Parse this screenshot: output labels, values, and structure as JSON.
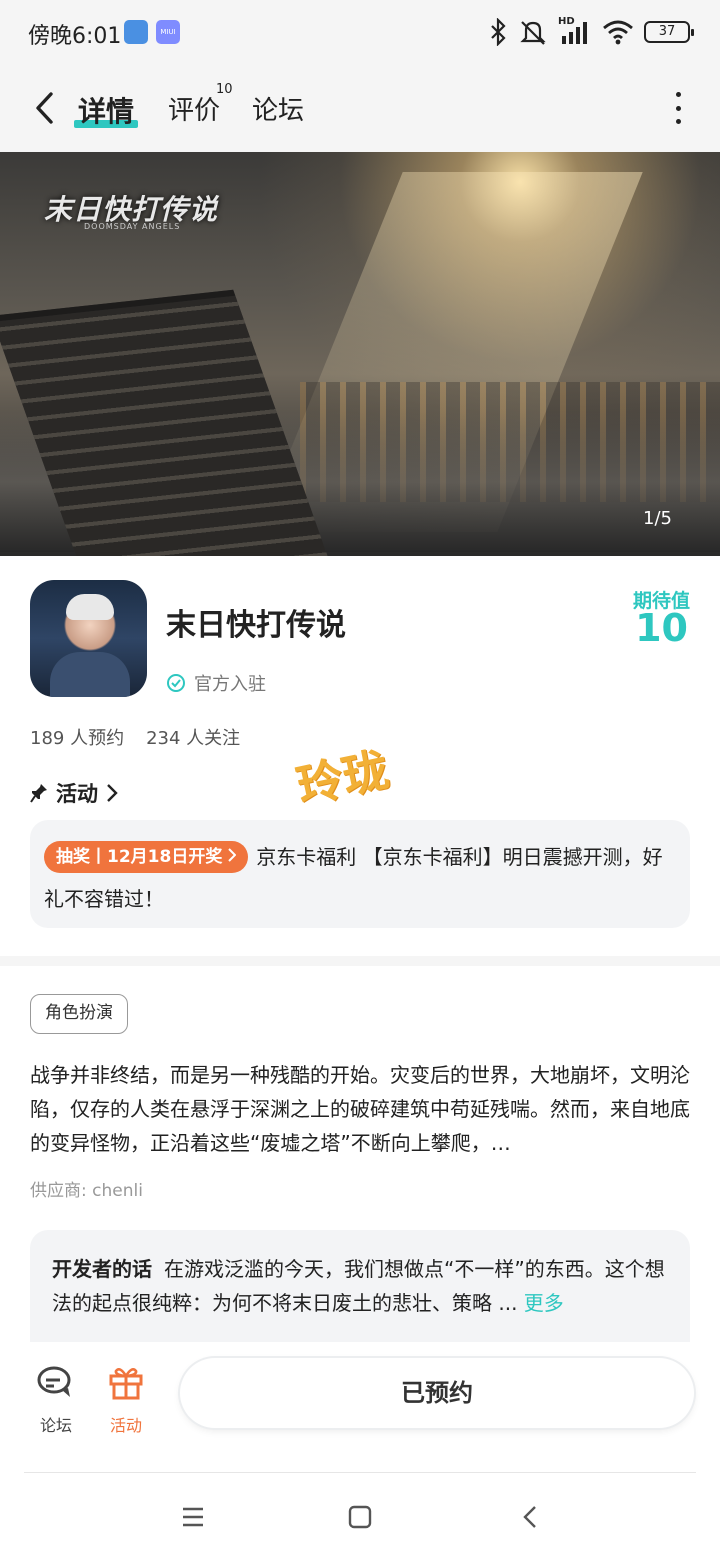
{
  "status_bar": {
    "time": "傍晚6:01",
    "miui_label": "MIUI",
    "hd_label": "HD",
    "battery": "37"
  },
  "nav": {
    "tabs": [
      {
        "label": "详情"
      },
      {
        "label": "评价"
      },
      {
        "label": "论坛"
      }
    ],
    "review_count": "10"
  },
  "banner": {
    "logo_text": "末日快打传说",
    "logo_subtitle": "DOOMSDAY ANGELS",
    "counter": "1/5"
  },
  "app": {
    "title": "末日快打传说",
    "official_label": "官方入驻",
    "expect_label": "期待值",
    "expect_value": "10",
    "reservations": "189 人预约",
    "followers": "234 人关注"
  },
  "activity": {
    "header": "活动",
    "tag": "抽奖丨12月18日开奖",
    "text": "京东卡福利 【京东卡福利】明日震撼开测，好礼不容错过！"
  },
  "watermark": "玲珑",
  "details": {
    "genre": "角色扮演",
    "description": "战争并非终结，而是另一种残酷的开始。灾变后的世界，大地崩坏，文明沦陷，仅存的人类在悬浮于深渊之上的破碎建筑中苟延残喘。然而，来自地底的变异怪物，正沿着这些“废墟之塔”不断向上攀爬，…",
    "supplier": "供应商: chenli"
  },
  "developer": {
    "label": "开发者的话",
    "text": "在游戏泛滥的今天，我们想做点“不一样”的东西。这个想法的起点很纯粹：为何不将末日废土的悲壮、策略 ...",
    "more": "更多"
  },
  "bottom_bar": {
    "forum_label": "论坛",
    "activity_label": "活动",
    "reserve_button": "已预约"
  },
  "colors": {
    "accent": "#2ec7c0",
    "orange": "#f0743d",
    "background": "#f5f5f5"
  }
}
